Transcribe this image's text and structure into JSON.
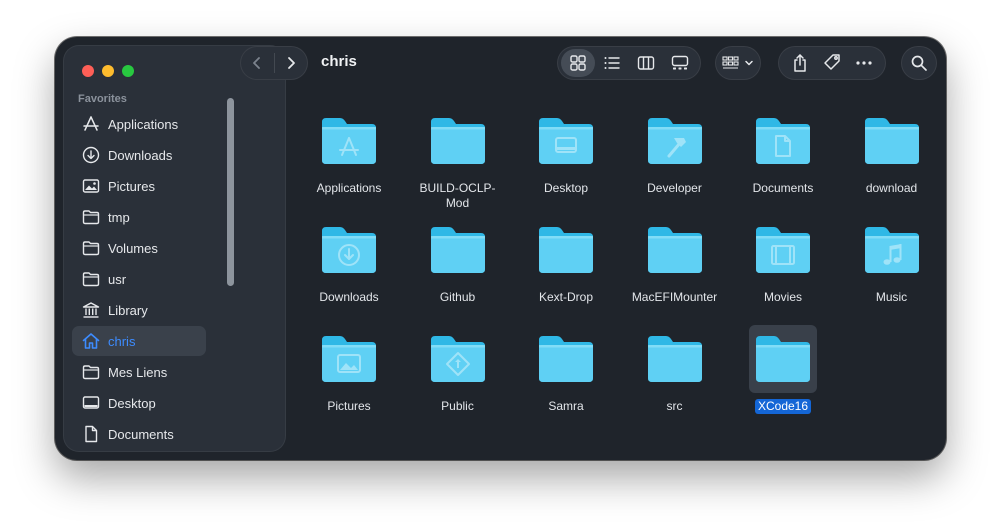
{
  "window": {
    "title": "chris"
  },
  "sidebar": {
    "section_title": "Favorites",
    "items": [
      {
        "label": "Applications",
        "icon": "applications-icon"
      },
      {
        "label": "Downloads",
        "icon": "download-circle-icon"
      },
      {
        "label": "Pictures",
        "icon": "photo-icon"
      },
      {
        "label": "tmp",
        "icon": "folder-icon"
      },
      {
        "label": "Volumes",
        "icon": "folder-icon"
      },
      {
        "label": "usr",
        "icon": "folder-icon"
      },
      {
        "label": "Library",
        "icon": "library-icon"
      },
      {
        "label": "chris",
        "icon": "home-icon",
        "active": true
      },
      {
        "label": "Mes Liens",
        "icon": "folder-icon"
      },
      {
        "label": "Desktop",
        "icon": "desktop-icon"
      },
      {
        "label": "Documents",
        "icon": "document-icon"
      }
    ]
  },
  "toolbar": {
    "views": [
      "icon-view",
      "list-view",
      "column-view",
      "gallery-view"
    ],
    "selected_view": "icon-view"
  },
  "files": [
    {
      "name": "Applications",
      "badge": "applications"
    },
    {
      "name": "BUILD-OCLP-\nMod",
      "badge": ""
    },
    {
      "name": "Desktop",
      "badge": "desktop"
    },
    {
      "name": "Developer",
      "badge": "hammer"
    },
    {
      "name": "Documents",
      "badge": "document"
    },
    {
      "name": "download",
      "badge": ""
    },
    {
      "name": "Downloads",
      "badge": "download"
    },
    {
      "name": "Github",
      "badge": ""
    },
    {
      "name": "Kext-Drop",
      "badge": ""
    },
    {
      "name": "MacEFIMounter",
      "badge": ""
    },
    {
      "name": "Movies",
      "badge": "film"
    },
    {
      "name": "Music",
      "badge": "music"
    },
    {
      "name": "Pictures",
      "badge": "photo"
    },
    {
      "name": "Public",
      "badge": "public"
    },
    {
      "name": "Samra",
      "badge": ""
    },
    {
      "name": "src",
      "badge": ""
    },
    {
      "name": "XCode16",
      "badge": "",
      "selected": true
    }
  ],
  "colors": {
    "folder_light": "#6ad6f6",
    "folder_dark": "#2fb8e6",
    "accent": "#3d8cff",
    "selection": "#1466d6"
  }
}
